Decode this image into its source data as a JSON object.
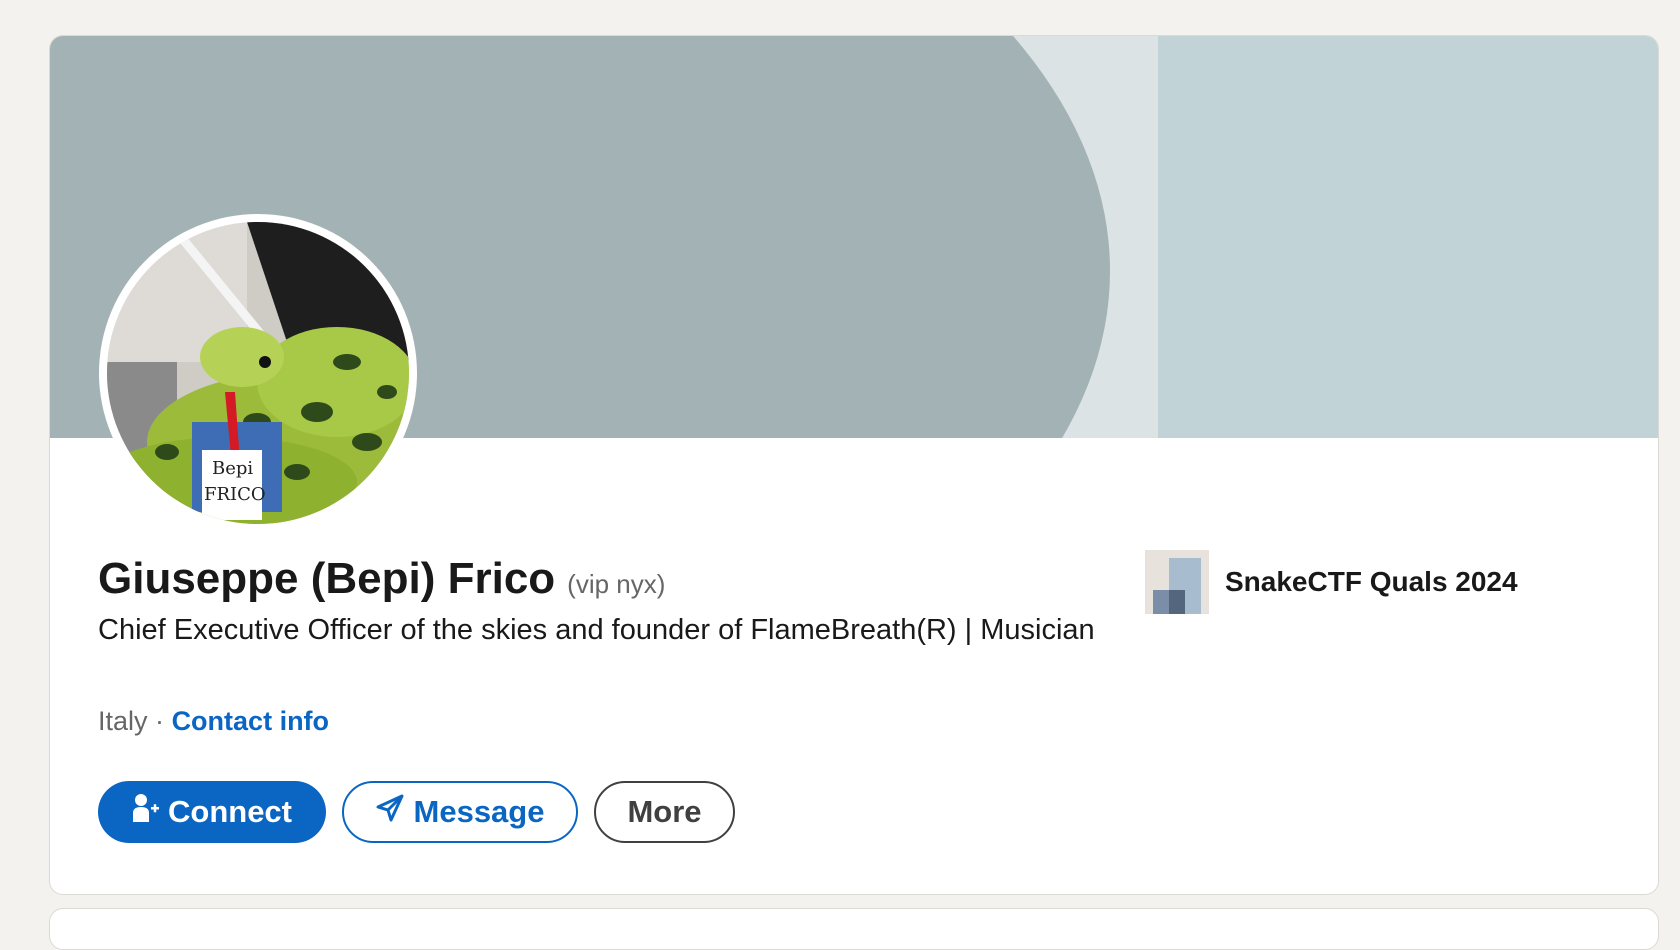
{
  "profile": {
    "name": "Giuseppe (Bepi) Frico",
    "pronoun": "(vip nyx)",
    "headline": "Chief Executive Officer of the skies and founder of FlameBreath(R) | Musician",
    "location": "Italy",
    "separator": "·",
    "contact_info_label": "Contact info",
    "avatar_badge_text": [
      "Bepi",
      "FRICO"
    ]
  },
  "actions": {
    "connect_label": "Connect",
    "message_label": "Message",
    "more_label": "More"
  },
  "experience": {
    "company_name": "SnakeCTF Quals 2024"
  },
  "icons": {
    "connect": "add-person-icon",
    "message": "send-plane-icon"
  },
  "colors": {
    "page_background": "#f4f2ee",
    "brand_blue": "#0a66c2",
    "banner_dark": "#a3b2b4",
    "banner_mid": "#dbe3e5",
    "banner_light": "#c1d3d6",
    "text_primary": "#191919",
    "text_secondary": "#666666"
  }
}
